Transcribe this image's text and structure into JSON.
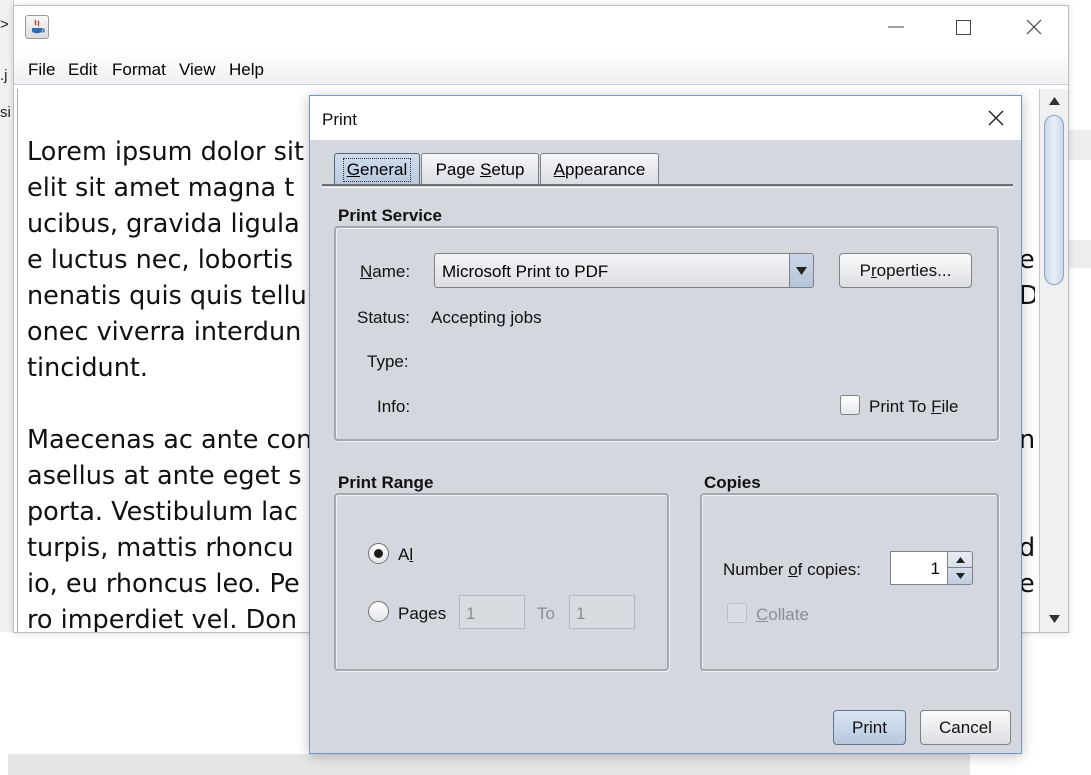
{
  "background": {
    "left_fragments": [
      ">",
      ".j",
      "si"
    ]
  },
  "editor": {
    "menu": [
      "File",
      "Edit",
      "Format",
      "View",
      "Help"
    ],
    "text_lines": [
      "Lorem ipsum dolor sit",
      "elit sit amet magna t",
      "ucibus, gravida ligula",
      "e luctus nec, lobortis",
      "nenatis quis quis tellu",
      "onec viverra interdun",
      "tincidunt.",
      "",
      "Maecenas ac ante con",
      "asellus at ante eget s",
      "porta. Vestibulum lac",
      "turpis, mattis rhoncu",
      "io, eu rhoncus leo. Pe",
      "ro imperdiet vel. Don"
    ],
    "right_edge_chars": [
      "e",
      "D",
      "n",
      "d",
      "e"
    ]
  },
  "dialog": {
    "title": "Print",
    "tabs": [
      {
        "pre": "",
        "ul": "G",
        "post": "eneral",
        "selected": true
      },
      {
        "pre": "Page ",
        "ul": "S",
        "post": "etup",
        "selected": false
      },
      {
        "pre": "",
        "ul": "A",
        "post": "ppearance",
        "selected": false
      }
    ],
    "print_service": {
      "heading": "Print Service",
      "name_label_ul": "N",
      "name_label_rest": "ame:",
      "printer": "Microsoft Print to PDF",
      "properties_pre": "P",
      "properties_ul": "r",
      "properties_post": "operties...",
      "status_label": "Status:",
      "status_value": "Accepting jobs",
      "type_label": "Type:",
      "info_label": "Info:",
      "print_to_file_pre": "Print To ",
      "print_to_file_ul": "F",
      "print_to_file_post": "ile"
    },
    "print_range": {
      "heading": "Print Range",
      "all_pre": "A",
      "all_ul": "l",
      "all_post": "l",
      "pages_pre": "Pa",
      "pages_ul": "g",
      "pages_post": "es",
      "from_value": "1",
      "to_label": "To",
      "to_value": "1"
    },
    "copies": {
      "heading": "Copies",
      "label_pre": "Number ",
      "label_ul": "o",
      "label_post": "f copies:",
      "value": "1",
      "collate_ul": "C",
      "collate_post": "ollate"
    },
    "buttons": {
      "print": "Print",
      "cancel": "Cancel"
    }
  }
}
